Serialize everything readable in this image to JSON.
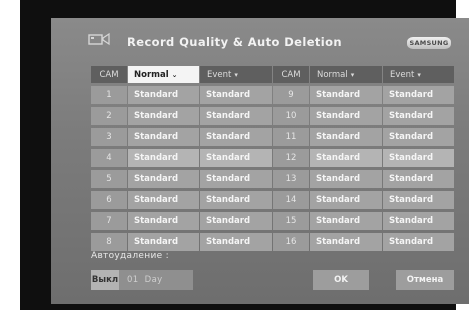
{
  "window": {
    "title": "Record Quality & Auto Deletion",
    "brand": "SAMSUNG"
  },
  "table": {
    "headers": {
      "cam_left": "CAM",
      "quality_left": "Normal",
      "event_left": "Event",
      "cam_right": "CAM",
      "quality_right": "Normal",
      "event_right": "Event"
    },
    "rows": [
      {
        "cam_left": "1",
        "q_left": "Standard",
        "e_left": "Standard",
        "cam_right": "9",
        "q_right": "Standard",
        "e_right": "Standard"
      },
      {
        "cam_left": "2",
        "q_left": "Standard",
        "e_left": "Standard",
        "cam_right": "10",
        "q_right": "Standard",
        "e_right": "Standard"
      },
      {
        "cam_left": "3",
        "q_left": "Standard",
        "e_left": "Standard",
        "cam_right": "11",
        "q_right": "Standard",
        "e_right": "Standard"
      },
      {
        "cam_left": "4",
        "q_left": "Standard",
        "e_left": "Standard",
        "cam_right": "12",
        "q_right": "Standard",
        "e_right": "Standard"
      },
      {
        "cam_left": "5",
        "q_left": "Standard",
        "e_left": "Standard",
        "cam_right": "13",
        "q_right": "Standard",
        "e_right": "Standard"
      },
      {
        "cam_left": "6",
        "q_left": "Standard",
        "e_left": "Standard",
        "cam_right": "14",
        "q_right": "Standard",
        "e_right": "Standard"
      },
      {
        "cam_left": "7",
        "q_left": "Standard",
        "e_left": "Standard",
        "cam_right": "15",
        "q_right": "Standard",
        "e_right": "Standard"
      },
      {
        "cam_left": "8",
        "q_left": "Standard",
        "e_left": "Standard",
        "cam_right": "16",
        "q_right": "Standard",
        "e_right": "Standard"
      }
    ]
  },
  "auto_delete": {
    "label": "Автоудаление :",
    "off_label": "Выкл",
    "value": "01",
    "unit": "Day"
  },
  "buttons": {
    "ok": "OK",
    "cancel": "Отмена"
  }
}
